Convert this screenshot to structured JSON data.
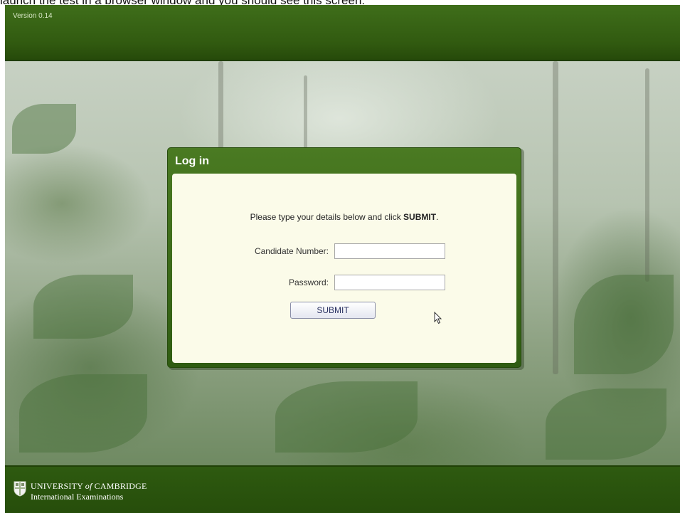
{
  "caption": "launch the test in a browser window and you should see this screen:",
  "header": {
    "version": "Version 0.14"
  },
  "login": {
    "title": "Log in",
    "instruction_prefix": "Please type your details below and click ",
    "instruction_bold": "SUBMIT",
    "instruction_suffix": ".",
    "candidate_label": "Candidate Number:",
    "candidate_value": "",
    "password_label": "Password:",
    "password_value": "",
    "submit_label": "SUBMIT"
  },
  "footer": {
    "crest_icon": "cambridge-crest-icon",
    "line1_prefix": "UNIVERSITY ",
    "line1_of": "of",
    "line1_suffix": " CAMBRIDGE",
    "line2": "International Examinations"
  },
  "colors": {
    "header_green": "#315a10",
    "footer_green": "#2e5a10",
    "panel_body": "#fbfbe9",
    "submit_text": "#283060"
  }
}
